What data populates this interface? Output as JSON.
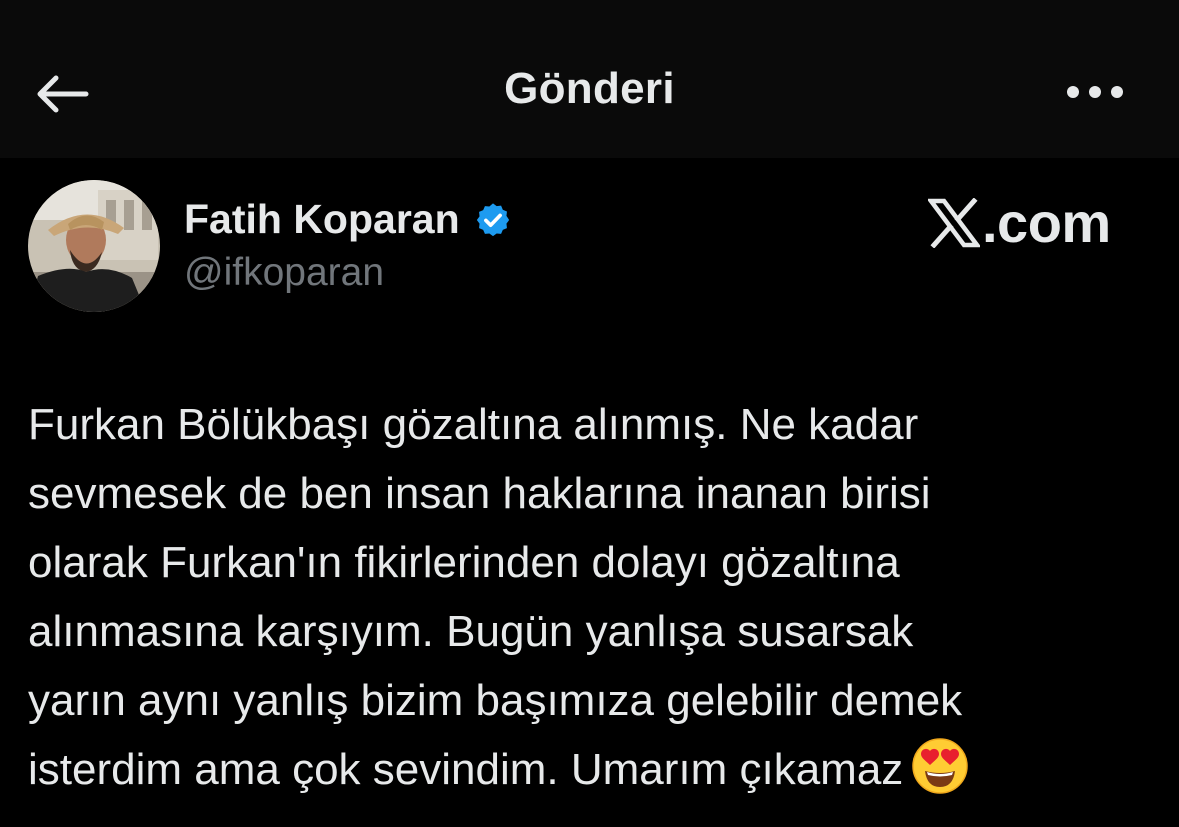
{
  "header": {
    "title": "Gönderi",
    "back_icon": "arrow-left-icon",
    "more_icon": "ellipsis-icon"
  },
  "author": {
    "name": "Fatih Koparan",
    "handle": "@ifkoparan",
    "verified": true,
    "verified_color": "#1d9bf0"
  },
  "watermark": {
    "logo": "x-logo-icon",
    "text": ".com"
  },
  "post": {
    "lines": [
      "Furkan Bölükbaşı gözaltına alınmış. Ne kadar",
      "sevmesek de ben insan haklarına inanan birisi",
      "olarak Furkan'ın fikirlerinden dolayı gözaltına",
      "alınmasına karşıyım. Bugün yanlışa susarsak",
      "yarın aynı yanlış bizim başımıza gelebilir demek",
      "isterdim ama çok sevindim. Umarım çıkamaz"
    ],
    "trailing_emoji": "smiling-face-with-heart-eyes"
  },
  "colors": {
    "background": "#000000",
    "header_bg": "#0a0a0a",
    "text_primary": "#e7e9ea",
    "text_secondary": "#71767b"
  }
}
